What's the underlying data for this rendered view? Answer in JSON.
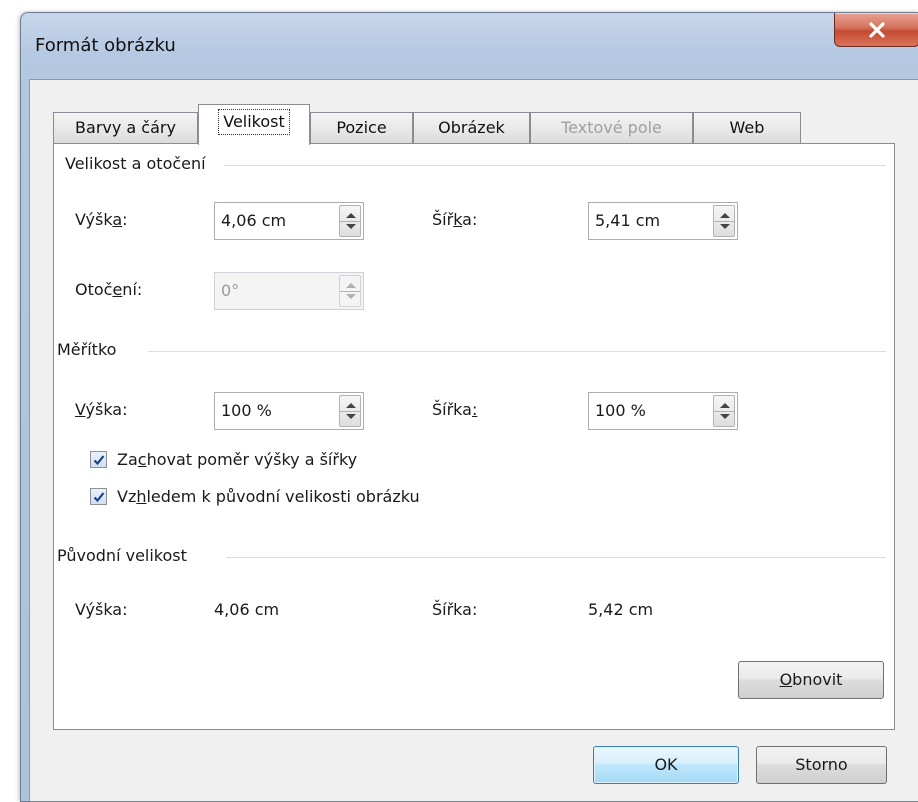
{
  "window": {
    "title": "Formát obrázku"
  },
  "tabs": [
    {
      "label": "Barvy a čáry",
      "state": "normal"
    },
    {
      "label": "Velikost",
      "state": "active"
    },
    {
      "label": "Pozice",
      "state": "normal"
    },
    {
      "label": "Obrázek",
      "state": "normal"
    },
    {
      "label": "Textové pole",
      "state": "disabled"
    },
    {
      "label": "Web",
      "state": "normal"
    }
  ],
  "size_rotate": {
    "title": "Velikost a otočení",
    "height_label_a": "Výšk",
    "height_label_u": "a",
    "height_label_b": ":",
    "height_value": "4,06 cm",
    "width_label_a": "Šíř",
    "width_label_u": "k",
    "width_label_b": "a:",
    "width_value": "5,41 cm",
    "rotation_label_a": "Otoč",
    "rotation_label_u": "e",
    "rotation_label_b": "ní:",
    "rotation_value": "0°"
  },
  "scale": {
    "title": "Měřítko",
    "height_label_u": "V",
    "height_label_b": "ýška:",
    "height_value": "100 %",
    "width_label_a": "Šířka",
    "width_label_u": ":",
    "width_value": "100 %",
    "lock_ratio_a": "Za",
    "lock_ratio_u": "c",
    "lock_ratio_b": "hovat poměr výšky a šířky",
    "lock_ratio_checked": true,
    "relative_a": "Vz",
    "relative_u": "h",
    "relative_b": "ledem k původní velikosti obrázku",
    "relative_checked": true
  },
  "original": {
    "title": "Původní velikost",
    "height_label": "Výška:",
    "height_value": "4,06 cm",
    "width_label": "Šířka:",
    "width_value": "5,42 cm",
    "reset_u": "O",
    "reset_b": "bnovit"
  },
  "buttons": {
    "ok": "OK",
    "cancel": "Storno"
  },
  "colors": {
    "close_button": "#c44a31",
    "default_button_border": "#3c7fb1",
    "title_bar": "#b6c9e2"
  },
  "icons": {
    "close": "close-icon",
    "checkbox": "checkmark-icon",
    "spin": "spin-arrows-icon"
  }
}
